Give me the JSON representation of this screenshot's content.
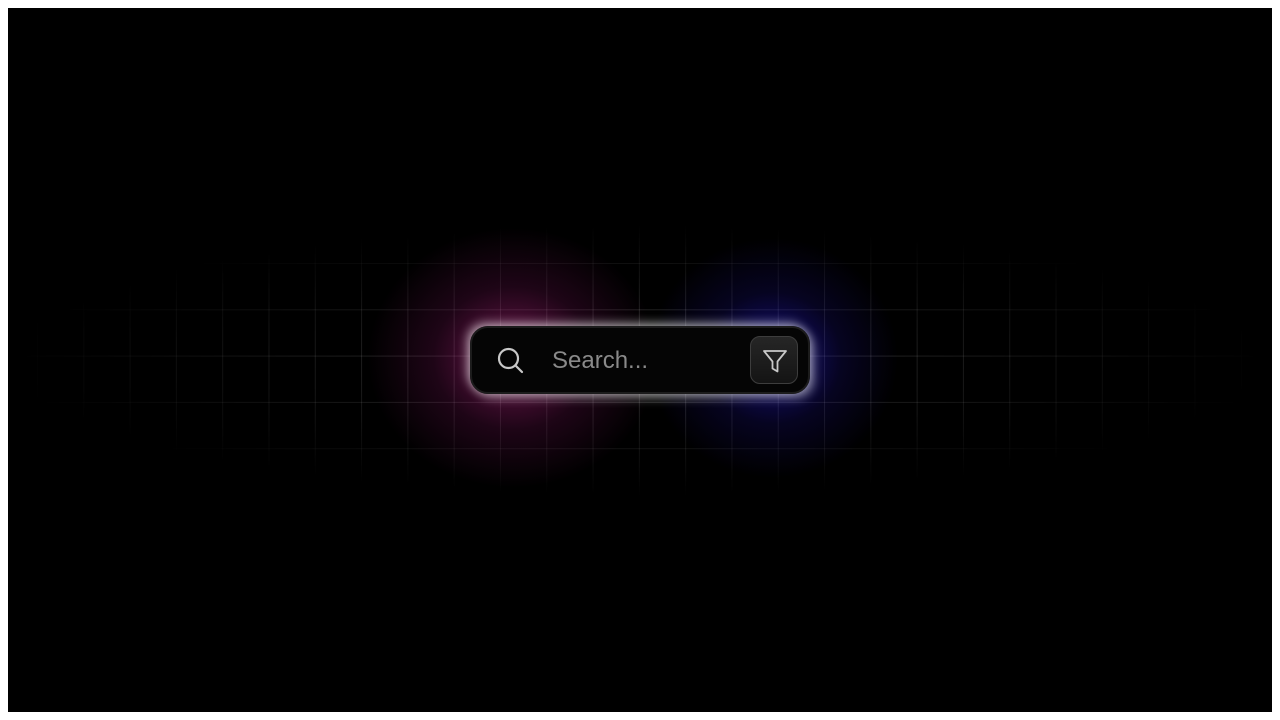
{
  "search": {
    "placeholder": "Search...",
    "value": ""
  },
  "icons": {
    "search": "search-icon",
    "filter": "filter-icon"
  },
  "colors": {
    "background": "#000000",
    "glow_left": "#c8288c",
    "glow_right": "#281ee6",
    "icon_stroke": "#c8c8c8"
  }
}
